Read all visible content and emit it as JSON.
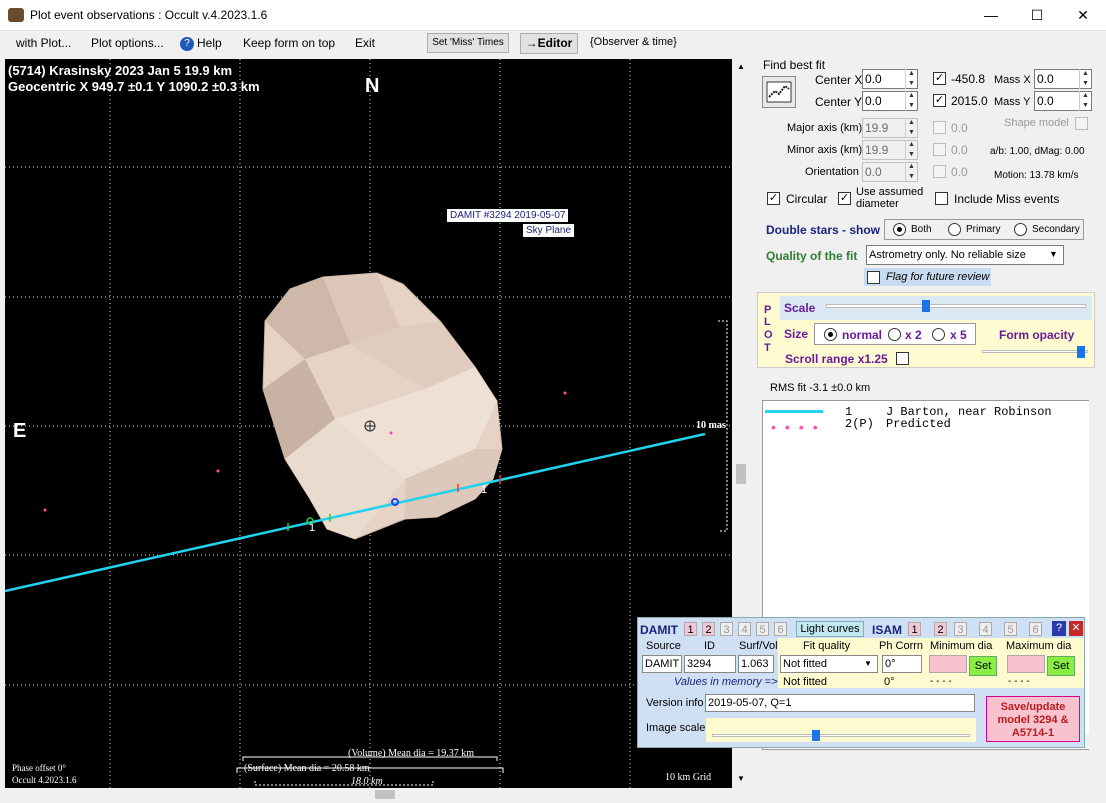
{
  "window": {
    "title": "Plot event observations : Occult v.4.2023.1.6"
  },
  "menu": {
    "with_plot": "with Plot...",
    "plot_options": "Plot options...",
    "help": "Help",
    "keep_form": "Keep form on top",
    "exit": "Exit",
    "set_miss_times": "Set 'Miss' Times",
    "editor": "→Editor",
    "observer_time": "{Observer & time}"
  },
  "plot": {
    "line1": "(5714) Krasinsky  2023 Jan 5   19.9 km",
    "line2": "Geocentric  X  949.7 ±0.1  Y  1090.2 ±0.3 km",
    "north": "N",
    "east": "E",
    "model_label1": "DAMIT #3294 2019-05-07",
    "model_label2": "Sky Plane",
    "scale_mas": "10 mas",
    "chord1_label": "1",
    "chord2_label": "1",
    "volume_dia": "(Volume) Mean dia = 19.37 km",
    "surface_dia": "(Surface) Mean dia = 20.58 km",
    "km_len": "18.0 km",
    "phase_offset": "Phase offset 0°",
    "occult_ver": "Occult 4.2023.1.6",
    "grid": "10 km Grid"
  },
  "fit": {
    "find_best_fit": "Find best fit",
    "center_x_label": "Center X",
    "center_x": "0.0",
    "center_y_label": "Center Y",
    "center_y": "0.0",
    "x_value": "-450.8",
    "y_value": "2015.0",
    "mass_x_label": "Mass X",
    "mass_x": "0.0",
    "mass_y_label": "Mass Y",
    "mass_y": "0.0",
    "major_label": "Major axis (km)",
    "major": "19.9",
    "minor_label": "Minor axis (km)",
    "minor": "19.9",
    "orient_label": "Orientation",
    "orient": "0.0",
    "d1": "0.0",
    "d2": "0.0",
    "d3": "0.0",
    "shape_model": "Shape model",
    "ab_dmag": "a/b: 1.00, dMag: 0.00",
    "motion": "Motion: 13.78 km/s",
    "circular": "Circular",
    "use_assumed": "Use assumed diameter",
    "include_miss": "Include Miss events",
    "double_stars": "Double stars - show",
    "both": "Both",
    "primary": "Primary",
    "secondary": "Secondary",
    "quality_label": "Quality of the fit",
    "quality_value": "Astrometry only. No reliable size",
    "flag_review": "Flag for future review"
  },
  "plotpanel": {
    "plot_letters": [
      "P",
      "L",
      "O",
      "T"
    ],
    "scale": "Scale",
    "size": "Size",
    "normal": "normal",
    "x2": "x 2",
    "x5": "x 5",
    "form_opacity": "Form opacity",
    "scroll_range": "Scroll range x1.25",
    "scale_fraction": 0.38,
    "opacity_fraction": 0.97
  },
  "rms": "RMS fit -3.1 ±0.0 km",
  "legend": [
    {
      "num": "1",
      "name": "J Barton, near Robinson"
    },
    {
      "num": "2(P)",
      "name": "Predicted"
    }
  ],
  "damit": {
    "title": "DAMIT",
    "buttons": [
      "1",
      "2",
      "3",
      "4",
      "5",
      "6"
    ],
    "light_curves": "Light curves",
    "isam": "ISAM",
    "isam_buttons": [
      "1",
      "1",
      "2",
      "2",
      "3",
      "4",
      "5",
      "6"
    ],
    "source_h": "Source",
    "id_h": "ID",
    "surf_h": "Surf/Vol",
    "fit_quality_h": "Fit quality",
    "ph_corrn_h": "Ph Corrn",
    "min_dia_h": "Minimum dia",
    "max_dia_h": "Maximum dia",
    "source": "DAMIT",
    "id": "3294",
    "surf": "1.063",
    "fit_quality": "Not fitted",
    "ph_corrn": "0°",
    "set": "Set",
    "values_memory": "Values in memory =>",
    "mem_fit": "Not fitted",
    "mem_ph": "0°",
    "mem_min": "- - - -",
    "mem_max": "- - - -",
    "version_label": "Version info",
    "version": "2019-05-07, Q=1",
    "image_scale": "Image scale",
    "image_scale_fraction": 0.4,
    "save_btn": "Save/update model 3294 & A5714-1"
  },
  "colors": {
    "chord": "#22d3ee",
    "predicted": "#ff4fa8",
    "asteroid": "#e7d3c6"
  }
}
